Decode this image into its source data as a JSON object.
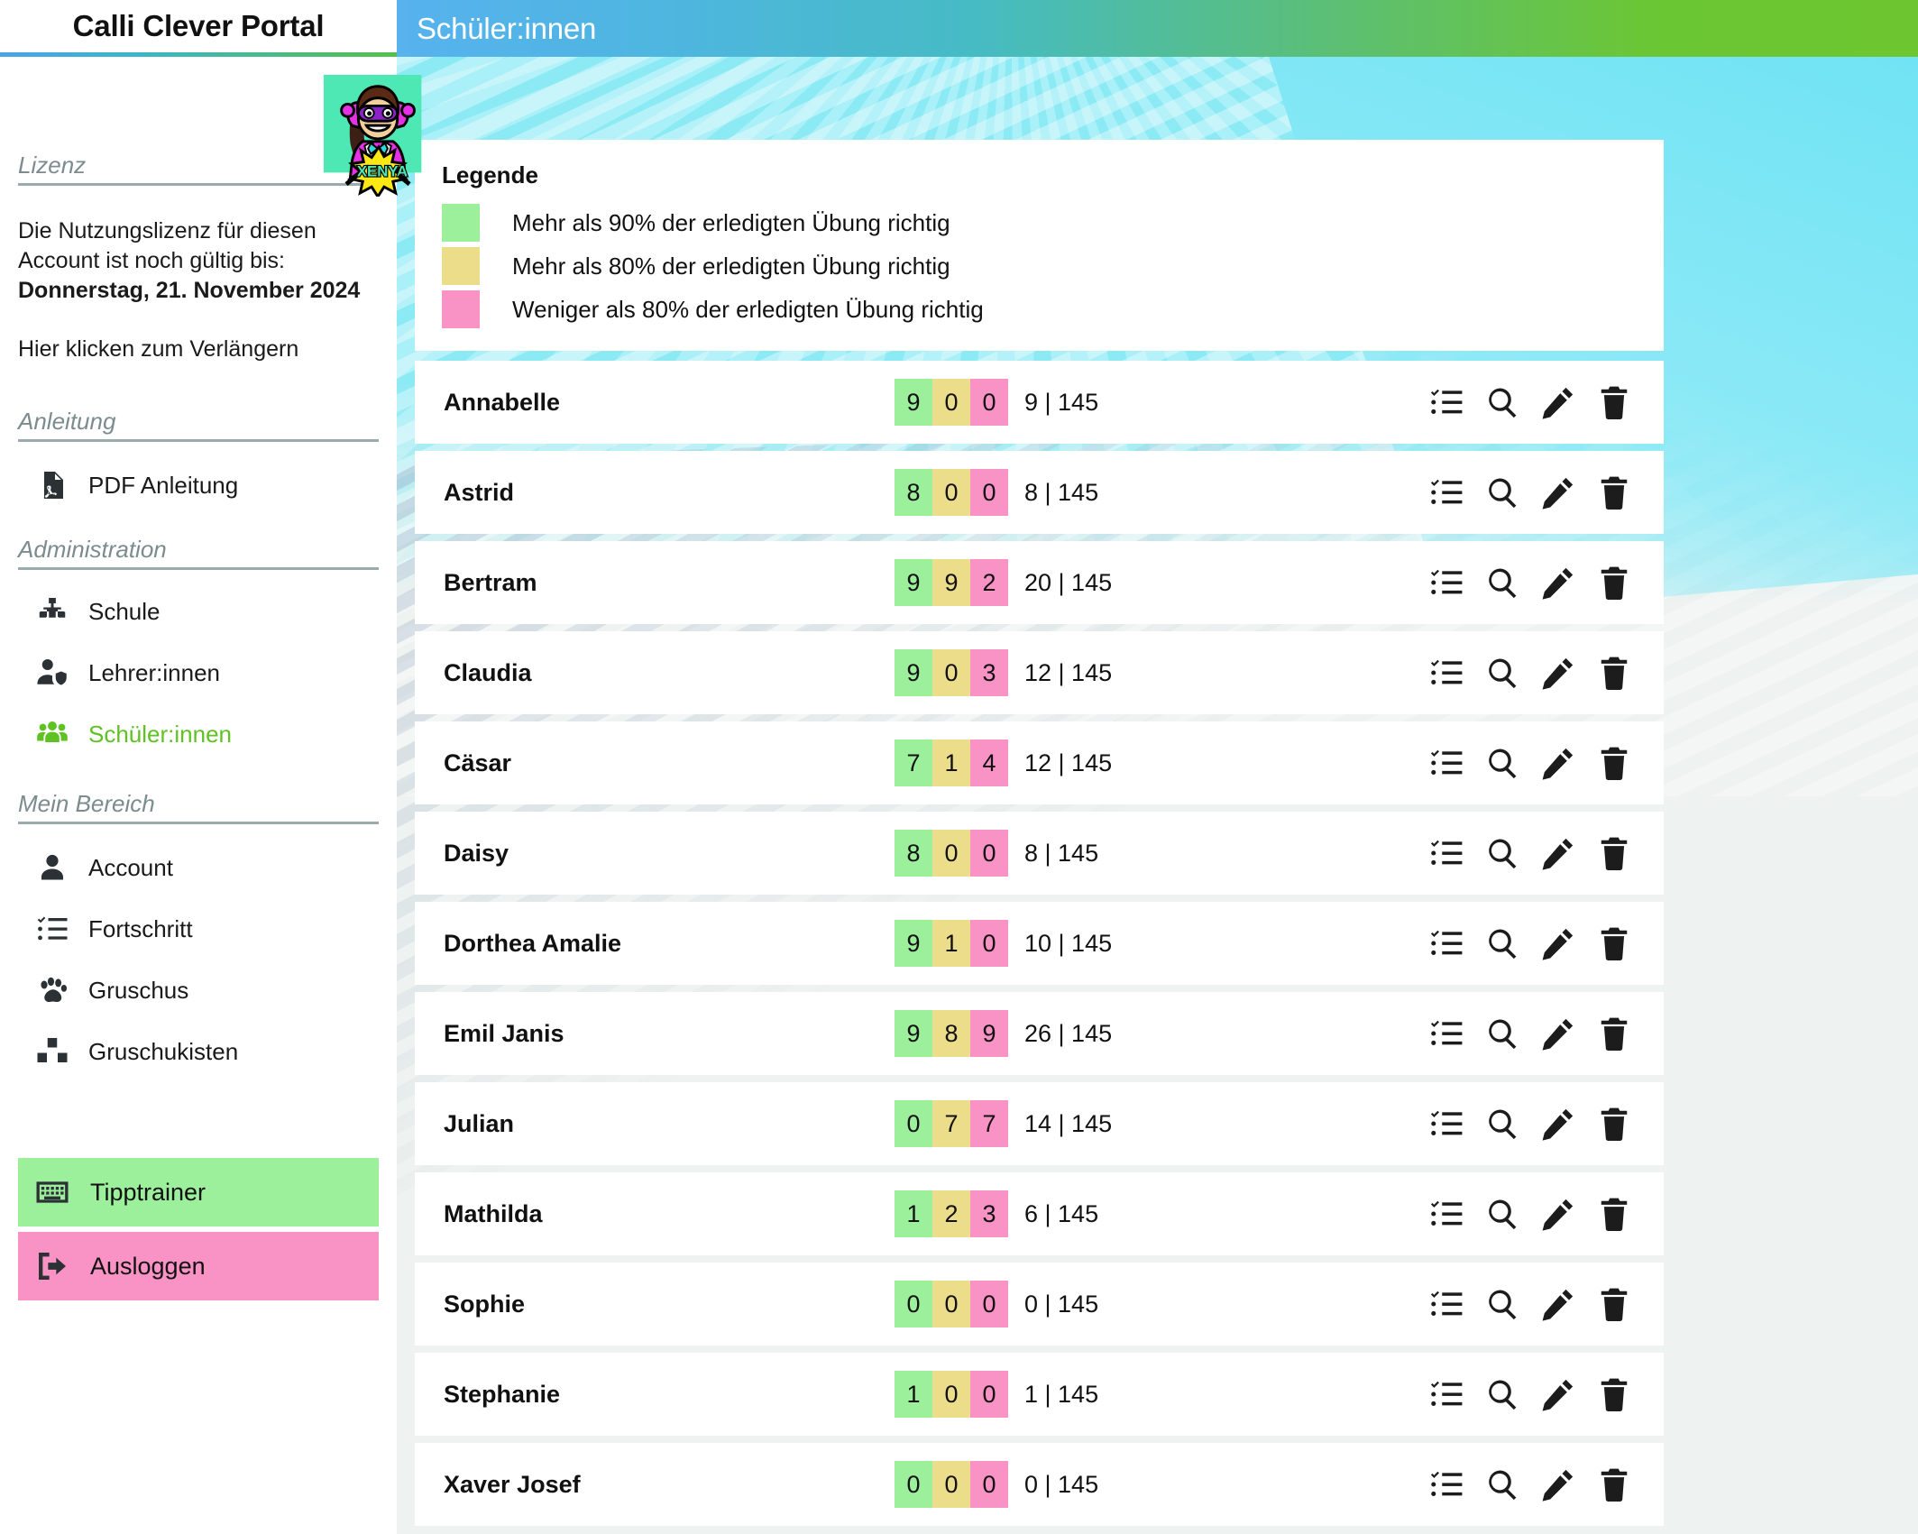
{
  "brand": {
    "title": "Calli Clever Portal"
  },
  "topbar": {
    "title": "Schüler:innen"
  },
  "avatar": {
    "name": "XENYA",
    "alt": "superhero-avatar"
  },
  "sidebar": {
    "license": {
      "heading": "Lizenz",
      "line1": "Die Nutzungslizenz für diesen",
      "line2": "Account ist noch gültig bis:",
      "date": "Donnerstag, 21. November 2024",
      "renew": "Hier klicken zum Verlängern"
    },
    "sections": [
      {
        "heading": "Anleitung",
        "items": [
          {
            "label": "PDF Anleitung",
            "icon": "pdf-file-icon",
            "active": false
          }
        ]
      },
      {
        "heading": "Administration",
        "items": [
          {
            "label": "Schule",
            "icon": "sitemap-icon",
            "active": false
          },
          {
            "label": "Lehrer:innen",
            "icon": "user-shield-icon",
            "active": false
          },
          {
            "label": "Schüler:innen",
            "icon": "users-group-icon",
            "active": true
          }
        ]
      },
      {
        "heading": "Mein Bereich",
        "items": [
          {
            "label": "Account",
            "icon": "user-icon",
            "active": false
          },
          {
            "label": "Fortschritt",
            "icon": "checklist-icon",
            "active": false
          },
          {
            "label": "Gruschus",
            "icon": "paw-icon",
            "active": false
          },
          {
            "label": "Gruschukisten",
            "icon": "boxes-icon",
            "active": false
          }
        ]
      }
    ],
    "buttons": [
      {
        "label": "Tipptrainer",
        "icon": "keyboard-icon",
        "color": "#9cf09c"
      },
      {
        "label": "Ausloggen",
        "icon": "logout-icon",
        "color": "#f993c5"
      }
    ]
  },
  "legend": {
    "title": "Legende",
    "items": [
      {
        "color": "#9cf09c",
        "text": "Mehr als 90% der erledigten Übung richtig"
      },
      {
        "color": "#ecdd8a",
        "text": "Mehr als 80% der erledigten Übung richtig"
      },
      {
        "color": "#f993c5",
        "text": "Weniger als 80% der erledigten Übung richtig"
      }
    ]
  },
  "row_actions": [
    {
      "icon": "checklist-icon",
      "name": "progress-action"
    },
    {
      "icon": "search-icon",
      "name": "view-action"
    },
    {
      "icon": "pencil-icon",
      "name": "edit-action"
    },
    {
      "icon": "trash-icon",
      "name": "delete-action"
    }
  ],
  "students": [
    {
      "name": "Annabelle",
      "green": "9",
      "yellow": "0",
      "pink": "0",
      "ratio": "9 | 145"
    },
    {
      "name": "Astrid",
      "green": "8",
      "yellow": "0",
      "pink": "0",
      "ratio": "8 | 145"
    },
    {
      "name": "Bertram",
      "green": "9",
      "yellow": "9",
      "pink": "2",
      "ratio": "20 | 145"
    },
    {
      "name": "Claudia",
      "green": "9",
      "yellow": "0",
      "pink": "3",
      "ratio": "12 | 145"
    },
    {
      "name": "Cäsar",
      "green": "7",
      "yellow": "1",
      "pink": "4",
      "ratio": "12 | 145"
    },
    {
      "name": "Daisy",
      "green": "8",
      "yellow": "0",
      "pink": "0",
      "ratio": "8 | 145"
    },
    {
      "name": "Dorthea Amalie",
      "green": "9",
      "yellow": "1",
      "pink": "0",
      "ratio": "10 | 145"
    },
    {
      "name": "Emil Janis",
      "green": "9",
      "yellow": "8",
      "pink": "9",
      "ratio": "26 | 145"
    },
    {
      "name": "Julian",
      "green": "0",
      "yellow": "7",
      "pink": "7",
      "ratio": "14 | 145"
    },
    {
      "name": "Mathilda",
      "green": "1",
      "yellow": "2",
      "pink": "3",
      "ratio": "6 | 145"
    },
    {
      "name": "Sophie",
      "green": "0",
      "yellow": "0",
      "pink": "0",
      "ratio": "0 | 145"
    },
    {
      "name": "Stephanie",
      "green": "1",
      "yellow": "0",
      "pink": "0",
      "ratio": "1 | 145"
    },
    {
      "name": "Xaver Josef",
      "green": "0",
      "yellow": "0",
      "pink": "0",
      "ratio": "0 | 145"
    }
  ]
}
